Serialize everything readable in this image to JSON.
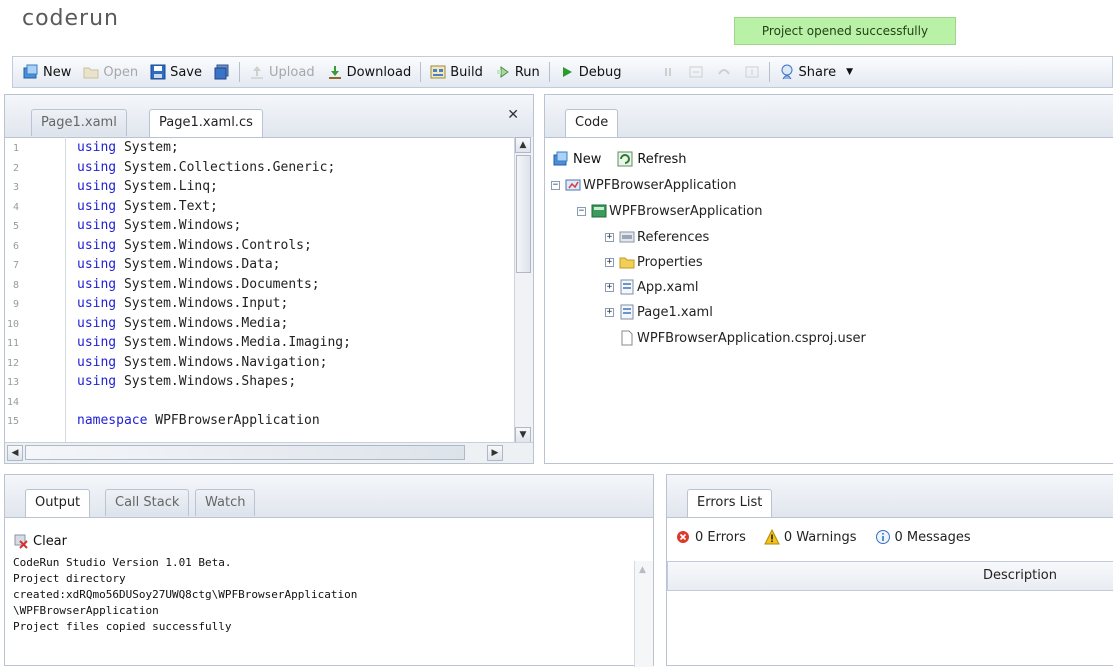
{
  "app": {
    "logo": "coderun",
    "notification": "Project opened successfully"
  },
  "toolbar": {
    "new": "New",
    "open": "Open",
    "save": "Save",
    "upload": "Upload",
    "download": "Download",
    "build": "Build",
    "run": "Run",
    "debug": "Debug",
    "share": "Share"
  },
  "editor": {
    "tabs": [
      "Page1.xaml",
      "Page1.xaml.cs"
    ],
    "active_tab": "Page1.xaml.cs",
    "lines": [
      {
        "n": "1",
        "kw": "using",
        "rest": " System;"
      },
      {
        "n": "2",
        "kw": "using",
        "rest": " System.Collections.Generic;"
      },
      {
        "n": "3",
        "kw": "using",
        "rest": " System.Linq;"
      },
      {
        "n": "4",
        "kw": "using",
        "rest": " System.Text;"
      },
      {
        "n": "5",
        "kw": "using",
        "rest": " System.Windows;"
      },
      {
        "n": "6",
        "kw": "using",
        "rest": " System.Windows.Controls;"
      },
      {
        "n": "7",
        "kw": "using",
        "rest": " System.Windows.Data;"
      },
      {
        "n": "8",
        "kw": "using",
        "rest": " System.Windows.Documents;"
      },
      {
        "n": "9",
        "kw": "using",
        "rest": " System.Windows.Input;"
      },
      {
        "n": "10",
        "kw": "using",
        "rest": " System.Windows.Media;"
      },
      {
        "n": "11",
        "kw": "using",
        "rest": " System.Windows.Media.Imaging;"
      },
      {
        "n": "12",
        "kw": "using",
        "rest": " System.Windows.Navigation;"
      },
      {
        "n": "13",
        "kw": "using",
        "rest": " System.Windows.Shapes;"
      },
      {
        "n": "14",
        "kw": "",
        "rest": ""
      },
      {
        "n": "15",
        "kw": "namespace",
        "rest": " WPFBrowserApplication"
      }
    ]
  },
  "code_panel": {
    "tab": "Code",
    "new": "New",
    "refresh": "Refresh",
    "tree": {
      "solution": "WPFBrowserApplication",
      "project": "WPFBrowserApplication",
      "references": "References",
      "properties": "Properties",
      "app_xaml": "App.xaml",
      "page1_xaml": "Page1.xaml",
      "csproj_user": "WPFBrowserApplication.csproj.user"
    }
  },
  "output": {
    "tabs": [
      "Output",
      "Call Stack",
      "Watch"
    ],
    "active_tab": "Output",
    "clear": "Clear",
    "text": "CodeRun Studio Version 1.01 Beta.\nProject directory\ncreated:xdRQmo56DUSoy27UWQ8ctg\\WPFBrowserApplication\n\\WPFBrowserApplication\nProject files copied successfully"
  },
  "errors": {
    "tab": "Errors List",
    "errors": "0 Errors",
    "warnings": "0 Warnings",
    "messages": "0 Messages",
    "column": "Description"
  },
  "colors": {
    "accent": "#2121d6",
    "toast_bg": "#b9f2a6",
    "border": "#b9c3d2"
  }
}
